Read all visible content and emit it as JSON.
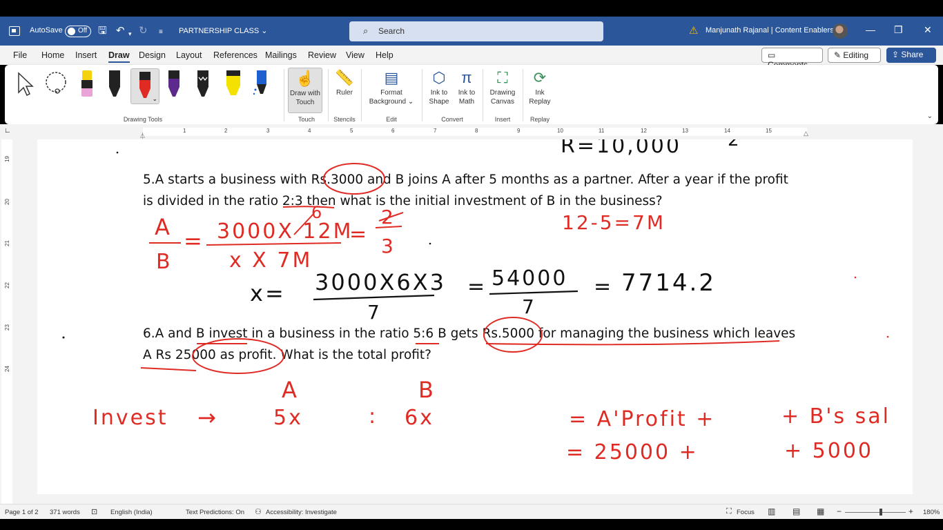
{
  "titlebar": {
    "autosave_label": "AutoSave",
    "autosave_state": "Off",
    "doc_title": "PARTNERSHIP CLASS",
    "search_placeholder": "Search",
    "user_name": "Manjunath Rajanal | Content Enablers"
  },
  "menu": {
    "tabs": [
      "File",
      "Home",
      "Insert",
      "Draw",
      "Design",
      "Layout",
      "References",
      "Mailings",
      "Review",
      "View",
      "Help"
    ],
    "active": "Draw",
    "comments": "Comments",
    "editing": "Editing",
    "share": "Share"
  },
  "ribbon": {
    "groups": {
      "drawing_tools": "Drawing Tools",
      "touch": "Touch",
      "stencils": "Stencils",
      "edit": "Edit",
      "convert": "Convert",
      "insert": "Insert",
      "replay": "Replay"
    },
    "buttons": {
      "draw_with_touch": [
        "Draw with",
        "Touch"
      ],
      "ruler": "Ruler",
      "format_background": [
        "Format",
        "Background"
      ],
      "ink_to_shape": [
        "Ink to",
        "Shape"
      ],
      "ink_to_math": [
        "Ink to",
        "Math"
      ],
      "drawing_canvas": [
        "Drawing",
        "Canvas"
      ],
      "ink_replay": [
        "Ink",
        "Replay"
      ]
    },
    "pen_colors": [
      "#111111",
      "#e02b24",
      "#5b2a8c",
      "#111111",
      "#f5e100",
      "#1e5fd1"
    ]
  },
  "ruler_numbers": [
    "1",
    "2",
    "3",
    "4",
    "5",
    "6",
    "7",
    "8",
    "9",
    "10",
    "11",
    "12",
    "13",
    "14",
    "15"
  ],
  "vruler_numbers": [
    "19",
    "20",
    "21",
    "22",
    "23",
    "24"
  ],
  "document": {
    "q5_line1": "5.A starts a business with Rs.3000 and B joins A after 5 months as a partner. After a year if the profit",
    "q5_line2": "is divided in the ratio 2:3 then what is the initial investment of B in the business?",
    "q6_line1": "6.A and B invest in a business in the ratio 5:6 B gets Rs.5000 for managing the business which leaves",
    "q6_line2": "A Rs 25000 as profit. What is the total profit?"
  },
  "handwriting": {
    "top_r": "R=10,000",
    "top_frag": "2",
    "a": "A",
    "b": "B",
    "frac_num": "3000X 12M",
    "six": "6",
    "frac_den": "x X 7M",
    "ratio_num": "2",
    "ratio_den": "3",
    "months": "12-5=7M",
    "x_lhs": "x=",
    "x_num": "3000X6X3",
    "x_den": "7",
    "eq1": "=",
    "mid_num": "54000",
    "mid_den": "7",
    "eq2": "=",
    "result": "7714.2",
    "col_a": "A",
    "col_b": "B",
    "invest": "Invest",
    "arrow": "→",
    "five_x": "5x",
    "colon": ":",
    "six_x": "6x",
    "a_profit": "= A'Profit +",
    "b_sal": "+ B's sal",
    "val_25000": "= 25000 +",
    "val_5000": "+ 5000"
  },
  "status": {
    "page": "Page 1 of 2",
    "words": "371 words",
    "language": "English (India)",
    "predictions": "Text Predictions: On",
    "accessibility": "Accessibility: Investigate",
    "focus": "Focus",
    "zoom": "180%"
  }
}
